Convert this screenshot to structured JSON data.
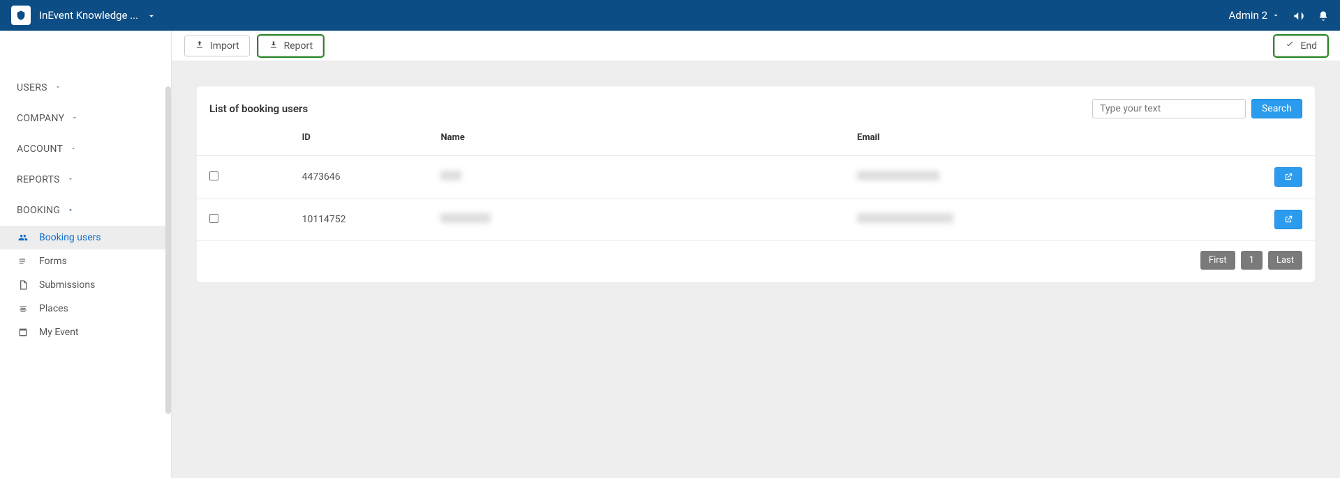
{
  "header": {
    "brand": "InEvent Knowledge ...",
    "user": "Admin 2"
  },
  "sidebar": {
    "sections": [
      {
        "label": "USERS",
        "expanded": false
      },
      {
        "label": "COMPANY",
        "expanded": false
      },
      {
        "label": "ACCOUNT",
        "expanded": false
      },
      {
        "label": "REPORTS",
        "expanded": false
      },
      {
        "label": "BOOKING",
        "expanded": true
      }
    ],
    "booking_items": [
      {
        "label": "Booking users",
        "active": true
      },
      {
        "label": "Forms",
        "active": false
      },
      {
        "label": "Submissions",
        "active": false
      },
      {
        "label": "Places",
        "active": false
      },
      {
        "label": "My Event",
        "active": false
      }
    ]
  },
  "actions": {
    "import": "Import",
    "report": "Report",
    "end": "End"
  },
  "card": {
    "title": "List of booking users",
    "search_placeholder": "Type your text",
    "search_button": "Search",
    "columns": {
      "id": "ID",
      "name": "Name",
      "email": "Email"
    },
    "rows": [
      {
        "id": "4473646",
        "name": "",
        "email": ""
      },
      {
        "id": "10114752",
        "name": "",
        "email": ""
      }
    ],
    "pagination": {
      "first": "First",
      "page": "1",
      "last": "Last"
    }
  }
}
